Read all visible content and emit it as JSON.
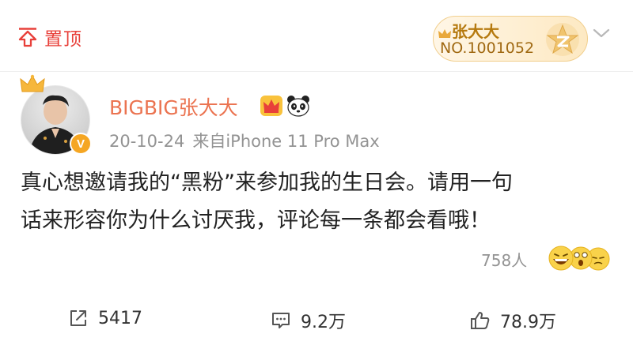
{
  "header": {
    "pin_label": "置顶",
    "badge": {
      "name": "张大大",
      "number": "NO.1001052"
    },
    "icons": {
      "pin": "pin-top-icon",
      "badge_star": "star-badge-icon",
      "menu": "chevron-down-icon"
    }
  },
  "post": {
    "author": "BIGBIG张大大",
    "time": "20-10-24",
    "source": "来自iPhone 11 Pro Max",
    "text_line1": "真心想邀请我的“黑粉”来参加我的生日会。请用一句",
    "text_line2": "话来形容你为什么讨厌我，评论每一条都会看哦！",
    "read_count": "758人",
    "avatar_badge": "V"
  },
  "actions": {
    "share_count": "5417",
    "comment_count": "9.2万",
    "like_count": "78.9万"
  },
  "colors": {
    "accent_red": "#e8403a",
    "username_orange": "#eb7350",
    "meta_gray": "#939393",
    "badge_gold": "#b5790e"
  }
}
